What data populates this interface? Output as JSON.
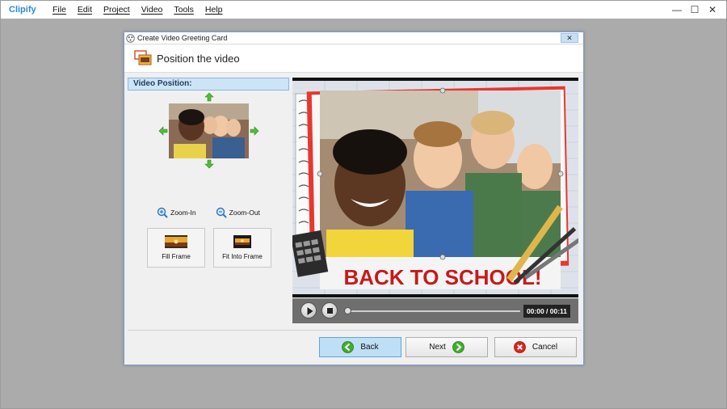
{
  "app": {
    "title": "Clipify",
    "menu": [
      "File",
      "Edit",
      "Project",
      "Video",
      "Tools",
      "Help"
    ],
    "window_controls": {
      "minimize": "—",
      "maximize": "☐",
      "close": "✕"
    }
  },
  "dialog": {
    "title": "Create Video Greeting Card",
    "close_glyph": "✕",
    "header": "Position the video",
    "panel_heading": "Video Position:",
    "zoom_in": "Zoom-In",
    "zoom_out": "Zoom-Out",
    "fill_frame": "Fill Frame",
    "fit_into_frame": "Fit Into Frame",
    "video": {
      "overlay_text": "BACK TO SCHOOL!",
      "timecode": "00:00 / 00:11",
      "progress": 0
    },
    "buttons": {
      "back": "Back",
      "next": "Next",
      "cancel": "Cancel"
    }
  },
  "colors": {
    "accent": "#2a8ad6",
    "back_button_bg": "#bfdff6",
    "green_icon": "#3fae2a",
    "cancel_icon": "#d9251d",
    "banner_red": "#c8191a"
  }
}
